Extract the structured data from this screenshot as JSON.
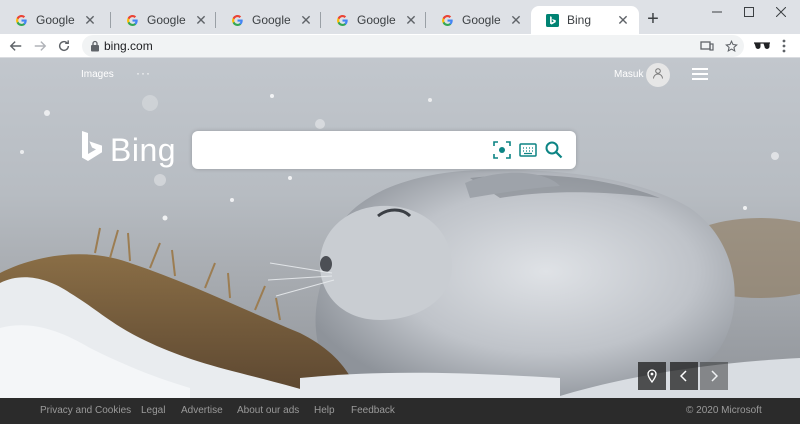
{
  "browser": {
    "tabs": [
      {
        "title": "Google",
        "favicon": "google-g-icon"
      },
      {
        "title": "Google",
        "favicon": "google-g-icon"
      },
      {
        "title": "Google",
        "favicon": "google-g-icon"
      },
      {
        "title": "Google",
        "favicon": "google-g-icon"
      },
      {
        "title": "Google",
        "favicon": "google-g-icon"
      },
      {
        "title": "Bing",
        "favicon": "bing-b-icon",
        "active": true
      }
    ],
    "new_tab_label": "+",
    "address": "bing.com",
    "colors": {
      "tabstrip": "#dee1e6",
      "toolbar": "#ffffff",
      "omnibox": "#f1f3f4"
    }
  },
  "bing": {
    "nav": {
      "images_label": "Images",
      "more_label": "···"
    },
    "user": {
      "name": "Masuk"
    },
    "logo_text": "Bing",
    "search": {
      "value": "",
      "placeholder": ""
    },
    "colors": {
      "brand": "#008373",
      "search_icon": "#0c8484"
    }
  },
  "footer": {
    "links": [
      "Privacy and Cookies",
      "Legal",
      "Advertise",
      "About our ads",
      "Help",
      "Feedback"
    ],
    "copyright": "© 2020 Microsoft"
  }
}
